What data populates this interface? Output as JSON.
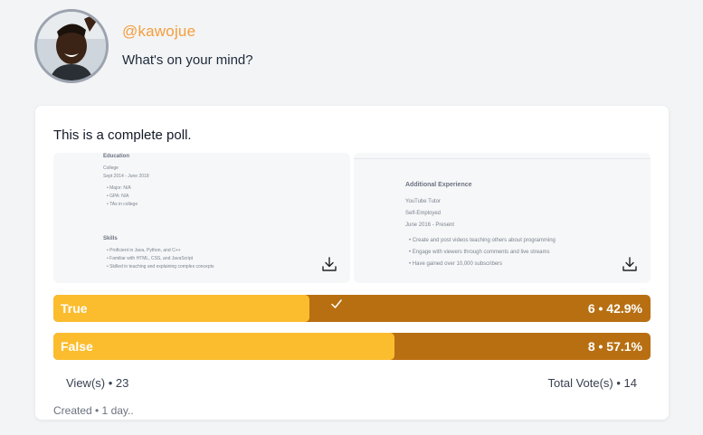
{
  "post": {
    "username": "@kawojue",
    "prompt": "What's on your mind?",
    "caption": "This is a complete poll."
  },
  "attachments": [
    {
      "education_heading": "Education",
      "education_lines": [
        "College",
        "Sept 2014 - June 2018"
      ],
      "education_bullets": [
        "Major: N/A",
        "GPA: N/A",
        "TAs in college"
      ],
      "skills_heading": "Skills",
      "skills_bullets": [
        "Proficient in Java, Python, and C++",
        "Familiar with HTML, CSS, and JavaScript",
        "Skilled in teaching and explaining complex concepts"
      ],
      "download_icon": "download-icon"
    },
    {
      "heading": "Additional Experience",
      "lines": [
        "YouTube Tutor",
        "Self-Employed",
        "June 2016 - Present"
      ],
      "bullets": [
        "Create and post videos teaching others about programming",
        "Engage with viewers through comments and live streams",
        "Have gained over 10,000 subscribers"
      ],
      "download_icon": "download-icon"
    }
  ],
  "poll": {
    "options": [
      {
        "label": "True",
        "stat": "6 • 42.9%",
        "votes": 6,
        "percent": 42.9,
        "selected": true
      },
      {
        "label": "False",
        "stat": "8 • 57.1%",
        "votes": 8,
        "percent": 57.1,
        "selected": false
      }
    ],
    "views": "View(s) • 23",
    "total_votes": "Total Vote(s) • 14",
    "created": "Created • 1 day.."
  },
  "colors": {
    "accent": "#f59e3b",
    "bar_fill": "#fbbd2e",
    "bar_track": "#b86f12"
  }
}
